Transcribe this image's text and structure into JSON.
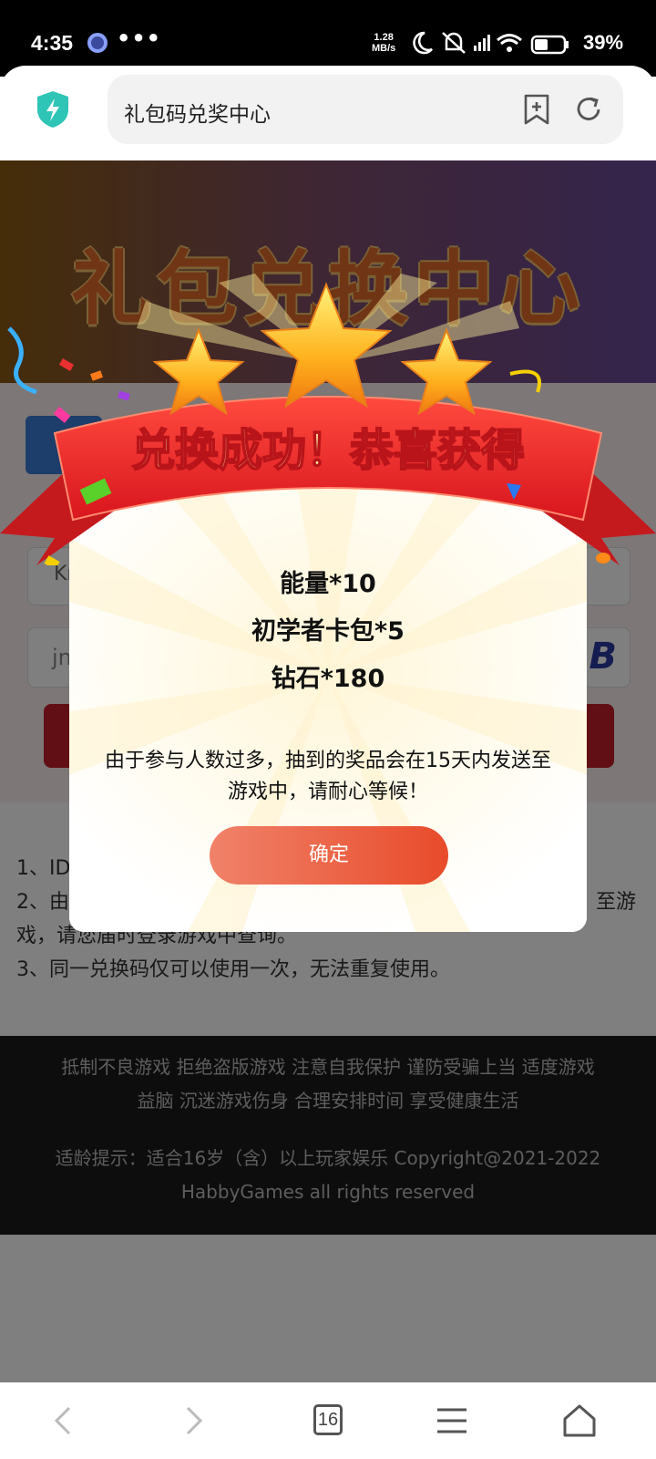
{
  "status_bar": {
    "time": "4:35",
    "dots": "•••",
    "net_speed_value": "1.28",
    "net_speed_unit": "MB/s",
    "battery": "39%"
  },
  "browser": {
    "url_title": "礼包码兑奖中心",
    "tab_count": "16",
    "shield_color": "#2ec4b6"
  },
  "page": {
    "hero_title": "礼包兑换中心",
    "field1_partial": "Kr",
    "field2_partial": "jn",
    "captcha_partial": "B",
    "notes": [
      "1、ID",
      "2、由",
      "至游",
      "戏，请您届时登录游戏中查询。",
      "3、同一兑换码仅可以使用一次，无法重复使用。"
    ],
    "footer_line1": "抵制不良游戏 拒绝盗版游戏 注意自我保护 谨防受骗上当 适度游戏",
    "footer_line2": "益脑 沉迷游戏伤身 合理安排时间 享受健康生活",
    "footer_line3": "适龄提示：适合16岁（含）以上玩家娱乐 Copyright@2021-2022",
    "footer_line4": "HabbyGames all rights reserved"
  },
  "modal": {
    "banner_text": "兑换成功！恭喜获得",
    "prizes": [
      "能量*10",
      "初学者卡包*5",
      "钻石*180"
    ],
    "notice": "由于参与人数过多，抽到的奖品会在15天内发送至游戏中，请耐心等候！",
    "confirm_label": "确定"
  },
  "colors": {
    "accent": "#e84b2a",
    "banner_red": "#e8282e",
    "star_gold": "#ffb21e"
  }
}
